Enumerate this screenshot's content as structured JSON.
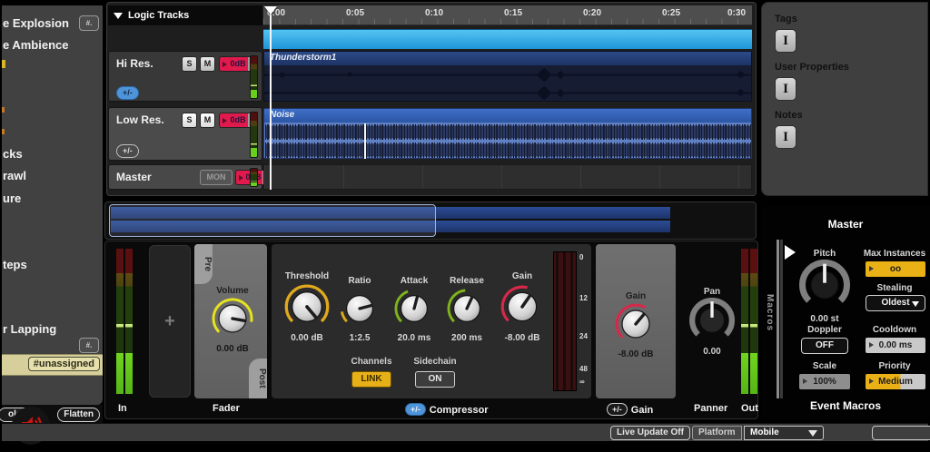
{
  "colors": {
    "accent_blue": "#2ba7e0",
    "clip_blue": "#5f7fc2",
    "record_red": "#e01a4c",
    "macro_yellow": "#eab117"
  },
  "sidebar": {
    "items": [
      {
        "label": "e Explosion"
      },
      {
        "label": "e Ambience"
      },
      {
        "label": "cks"
      },
      {
        "label": "rawl"
      },
      {
        "label": "ure"
      },
      {
        "label": "teps"
      },
      {
        "label": "r Lapping"
      }
    ],
    "hash_badge": "#.",
    "unassigned_tag": "#unassigned",
    "folder_button": "older",
    "flatten_button": "Flatten"
  },
  "tracks": {
    "header": "Logic Tracks",
    "rows": [
      {
        "name": "Hi Res.",
        "solo": "S",
        "mute": "M",
        "fader_db": "0dB",
        "expand": "+/-"
      },
      {
        "name": "Low Res.",
        "solo": "S",
        "mute": "M",
        "fader_db": "0dB",
        "expand": "+/-"
      },
      {
        "name": "Master",
        "monitor": "MON",
        "fader_db": "0dB"
      }
    ]
  },
  "timeline": {
    "ruler": [
      "0:00",
      "0:05",
      "0:10",
      "0:15",
      "0:20",
      "0:25",
      "0:30"
    ],
    "clip1": "Thunderstorm1",
    "clip2": "Noise"
  },
  "properties": {
    "tags": "Tags",
    "user_properties": "User Properties",
    "notes": "Notes",
    "ibeam": "I"
  },
  "deck": {
    "in_label": "In",
    "add_button": "+",
    "fader": {
      "label": "Fader",
      "pre": "Pre",
      "post": "Post",
      "knob": "Volume",
      "value": "0.00 dB"
    },
    "compressor": {
      "label": "Compressor",
      "plusminus": "+/-",
      "knobs": [
        {
          "label": "Threshold",
          "value": "0.00 dB"
        },
        {
          "label": "Ratio",
          "value": "1:2.5"
        },
        {
          "label": "Attack",
          "value": "20.0 ms"
        },
        {
          "label": "Release",
          "value": "200 ms"
        },
        {
          "label": "Gain",
          "value": "-8.00 dB"
        }
      ],
      "channels": "Channels",
      "link": "LINK",
      "sidechain": "Sidechain",
      "on": "ON",
      "meter_scale": [
        "0",
        "12",
        "24",
        "48",
        "∞"
      ]
    },
    "gain": {
      "label": "Gain",
      "plusminus": "+/-",
      "knob": "Gain",
      "value": "-8.00 dB"
    },
    "panner": {
      "label": "Panner",
      "knob": "Pan",
      "value": "0.00"
    },
    "out_label": "Out"
  },
  "macros": {
    "title": "Master",
    "footer": "Event Macros",
    "strip": "Macros",
    "pitch_label": "Pitch",
    "pitch_value": "0.00 st",
    "max_label": "Max Instances",
    "max_value": "oo",
    "stealing_label": "Stealing",
    "stealing_value": "Oldest",
    "doppler_label": "Doppler",
    "doppler_value": "OFF",
    "cooldown_label": "Cooldown",
    "cooldown_value": "0.00 ms",
    "scale_label": "Scale",
    "scale_value": "100%",
    "priority_label": "Priority",
    "priority_value": "Medium"
  },
  "status": {
    "live_update": "Live Update Off",
    "platform": "Platform",
    "platform_value": "Mobile"
  }
}
